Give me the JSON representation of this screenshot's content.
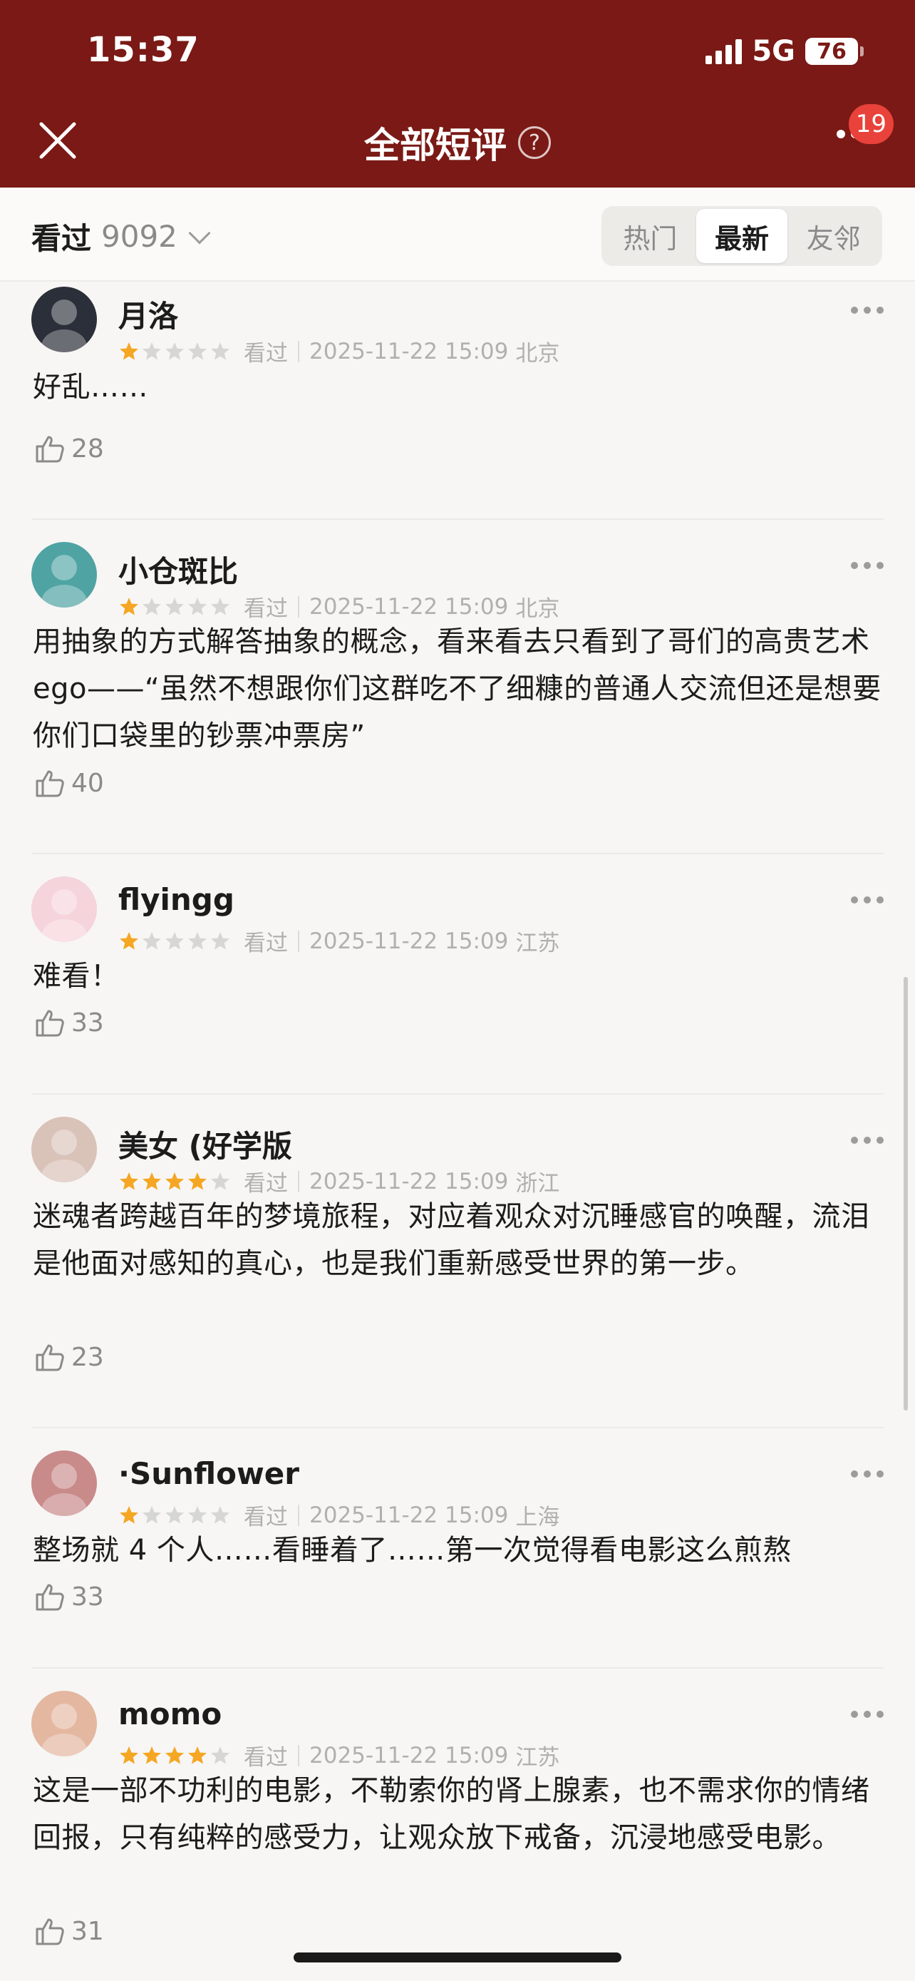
{
  "status": {
    "time": "15:37",
    "network": "5G",
    "battery": "76"
  },
  "nav": {
    "title": "全部短评",
    "help": "?",
    "badge": "19"
  },
  "filter": {
    "seen_label": "看过",
    "seen_count": "9092",
    "tabs": [
      {
        "label": "热门",
        "active": false
      },
      {
        "label": "最新",
        "active": true
      },
      {
        "label": "友邻",
        "active": false
      }
    ]
  },
  "comments": [
    {
      "user": "月洛",
      "stars": 1,
      "status": "看过",
      "time": "2025-11-22 15:09",
      "location": "北京",
      "content": "好乱……",
      "likes": "28",
      "avatar_color": "#2b2f3a"
    },
    {
      "user": "小仓斑比",
      "stars": 1,
      "status": "看过",
      "time": "2025-11-22 15:09",
      "location": "北京",
      "content": "用抽象的方式解答抽象的概念，看来看去只看到了哥们的高贵艺术 ego——“虽然不想跟你们这群吃不了细糠的普通人交流但还是想要你们口袋里的钞票冲票房”",
      "likes": "40",
      "avatar_color": "#4fa3a3"
    },
    {
      "user": "flyingg",
      "stars": 1,
      "status": "看过",
      "time": "2025-11-22 15:09",
      "location": "江苏",
      "content": "难看！",
      "likes": "33",
      "avatar_color": "#f6d4dc"
    },
    {
      "user": "美女 (好学版",
      "stars": 4,
      "status": "看过",
      "time": "2025-11-22 15:09",
      "location": "浙江",
      "content": "迷魂者跨越百年的梦境旅程，对应着观众对沉睡感官的唤醒，流泪是他面对感知的真心，也是我们重新感受世界的第一步。",
      "likes": "23",
      "avatar_color": "#d9c2b8"
    },
    {
      "user": "·Sunflower",
      "stars": 1,
      "status": "看过",
      "time": "2025-11-22 15:09",
      "location": "上海",
      "content": "整场就 4 个人……看睡着了……第一次觉得看电影这么煎熬",
      "likes": "33",
      "avatar_color": "#c98a8a"
    },
    {
      "user": "momo",
      "stars": 4,
      "status": "看过",
      "time": "2025-11-22 15:09",
      "location": "江苏",
      "content": "这是一部不功利的电影，不勒索你的肾上腺素，也不需求你的情绪回报，只有纯粹的感受力，让观众放下戒备，沉浸地感受电影。",
      "likes": "31",
      "avatar_color": "#e4b7a0"
    }
  ],
  "colors": {
    "brand": "#7a1915",
    "star_on": "#f5a623",
    "star_off": "#d6d6d6",
    "badge": "#e8423a"
  }
}
